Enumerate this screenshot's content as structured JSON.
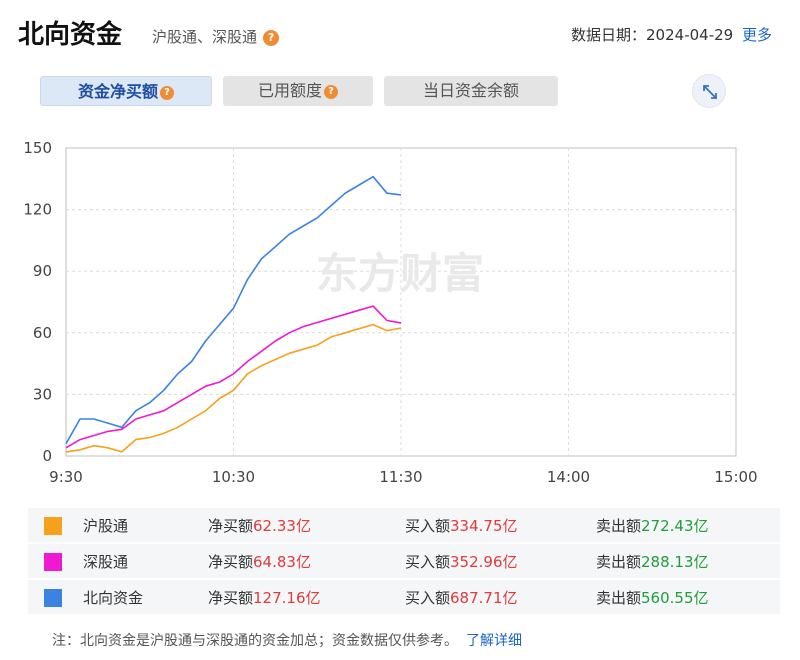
{
  "header": {
    "title": "北向资金",
    "subtitle": "沪股通、深股通",
    "date_label": "数据日期：",
    "date_value": "2024-04-29",
    "more_label": "更多"
  },
  "tabs": [
    {
      "label": "资金净买额",
      "active": true
    },
    {
      "label": "已用额度",
      "active": false
    },
    {
      "label": "当日资金余额",
      "active": false
    }
  ],
  "watermark": "东方财富",
  "chart_data": {
    "type": "line",
    "y_ticks": [
      "0",
      "30",
      "60",
      "90",
      "120",
      "150"
    ],
    "x_ticks": [
      "9:30",
      "10:30",
      "11:30",
      "14:00",
      "15:00"
    ],
    "ylim": [
      0,
      150
    ],
    "grid": true,
    "series": [
      {
        "name": "沪股通",
        "color": "#f6a11c",
        "x": [
          "9:30",
          "9:35",
          "9:40",
          "9:45",
          "9:50",
          "9:55",
          "10:00",
          "10:05",
          "10:10",
          "10:15",
          "10:20",
          "10:25",
          "10:30",
          "10:35",
          "10:40",
          "10:45",
          "10:50",
          "10:55",
          "11:00",
          "11:05",
          "11:10",
          "11:15",
          "11:20",
          "11:25",
          "11:30"
        ],
        "values": [
          2,
          3,
          5,
          4,
          2,
          8,
          9,
          11,
          14,
          18,
          22,
          28,
          32,
          40,
          44,
          47,
          50,
          52,
          54,
          58,
          60,
          62,
          64,
          61,
          62.33
        ]
      },
      {
        "name": "深股通",
        "color": "#f019d2",
        "x": [
          "9:30",
          "9:35",
          "9:40",
          "9:45",
          "9:50",
          "9:55",
          "10:00",
          "10:05",
          "10:10",
          "10:15",
          "10:20",
          "10:25",
          "10:30",
          "10:35",
          "10:40",
          "10:45",
          "10:50",
          "10:55",
          "11:00",
          "11:05",
          "11:10",
          "11:15",
          "11:20",
          "11:25",
          "11:30"
        ],
        "values": [
          4,
          8,
          10,
          12,
          13,
          18,
          20,
          22,
          26,
          30,
          34,
          36,
          40,
          46,
          51,
          56,
          60,
          63,
          65,
          67,
          69,
          71,
          73,
          66,
          64.83
        ]
      },
      {
        "name": "北向资金",
        "color": "#3a83e3",
        "x": [
          "9:30",
          "9:35",
          "9:40",
          "9:45",
          "9:50",
          "9:55",
          "10:00",
          "10:05",
          "10:10",
          "10:15",
          "10:20",
          "10:25",
          "10:30",
          "10:35",
          "10:40",
          "10:45",
          "10:50",
          "10:55",
          "11:00",
          "11:05",
          "11:10",
          "11:15",
          "11:20",
          "11:25",
          "11:30"
        ],
        "values": [
          6,
          18,
          18,
          16,
          14,
          22,
          26,
          32,
          40,
          46,
          56,
          64,
          72,
          86,
          96,
          102,
          108,
          112,
          116,
          122,
          128,
          132,
          136,
          128,
          127.16
        ]
      }
    ]
  },
  "legend": [
    {
      "name": "沪股通",
      "color": "#f6a11c",
      "net_label": "净买额",
      "net": "62.33亿",
      "buy_label": "买入额",
      "buy": "334.75亿",
      "sell_label": "卖出额",
      "sell": "272.43亿"
    },
    {
      "name": "深股通",
      "color": "#f019d2",
      "net_label": "净买额",
      "net": "64.83亿",
      "buy_label": "买入额",
      "buy": "352.96亿",
      "sell_label": "卖出额",
      "sell": "288.13亿"
    },
    {
      "name": "北向资金",
      "color": "#3a83e3",
      "net_label": "净买额",
      "net": "127.16亿",
      "buy_label": "买入额",
      "buy": "687.71亿",
      "sell_label": "卖出额",
      "sell": "560.55亿"
    }
  ],
  "footnote": {
    "text": "注：北向资金是沪股通与深股通的资金加总；资金数据仅供参考。",
    "link": "了解详细"
  }
}
